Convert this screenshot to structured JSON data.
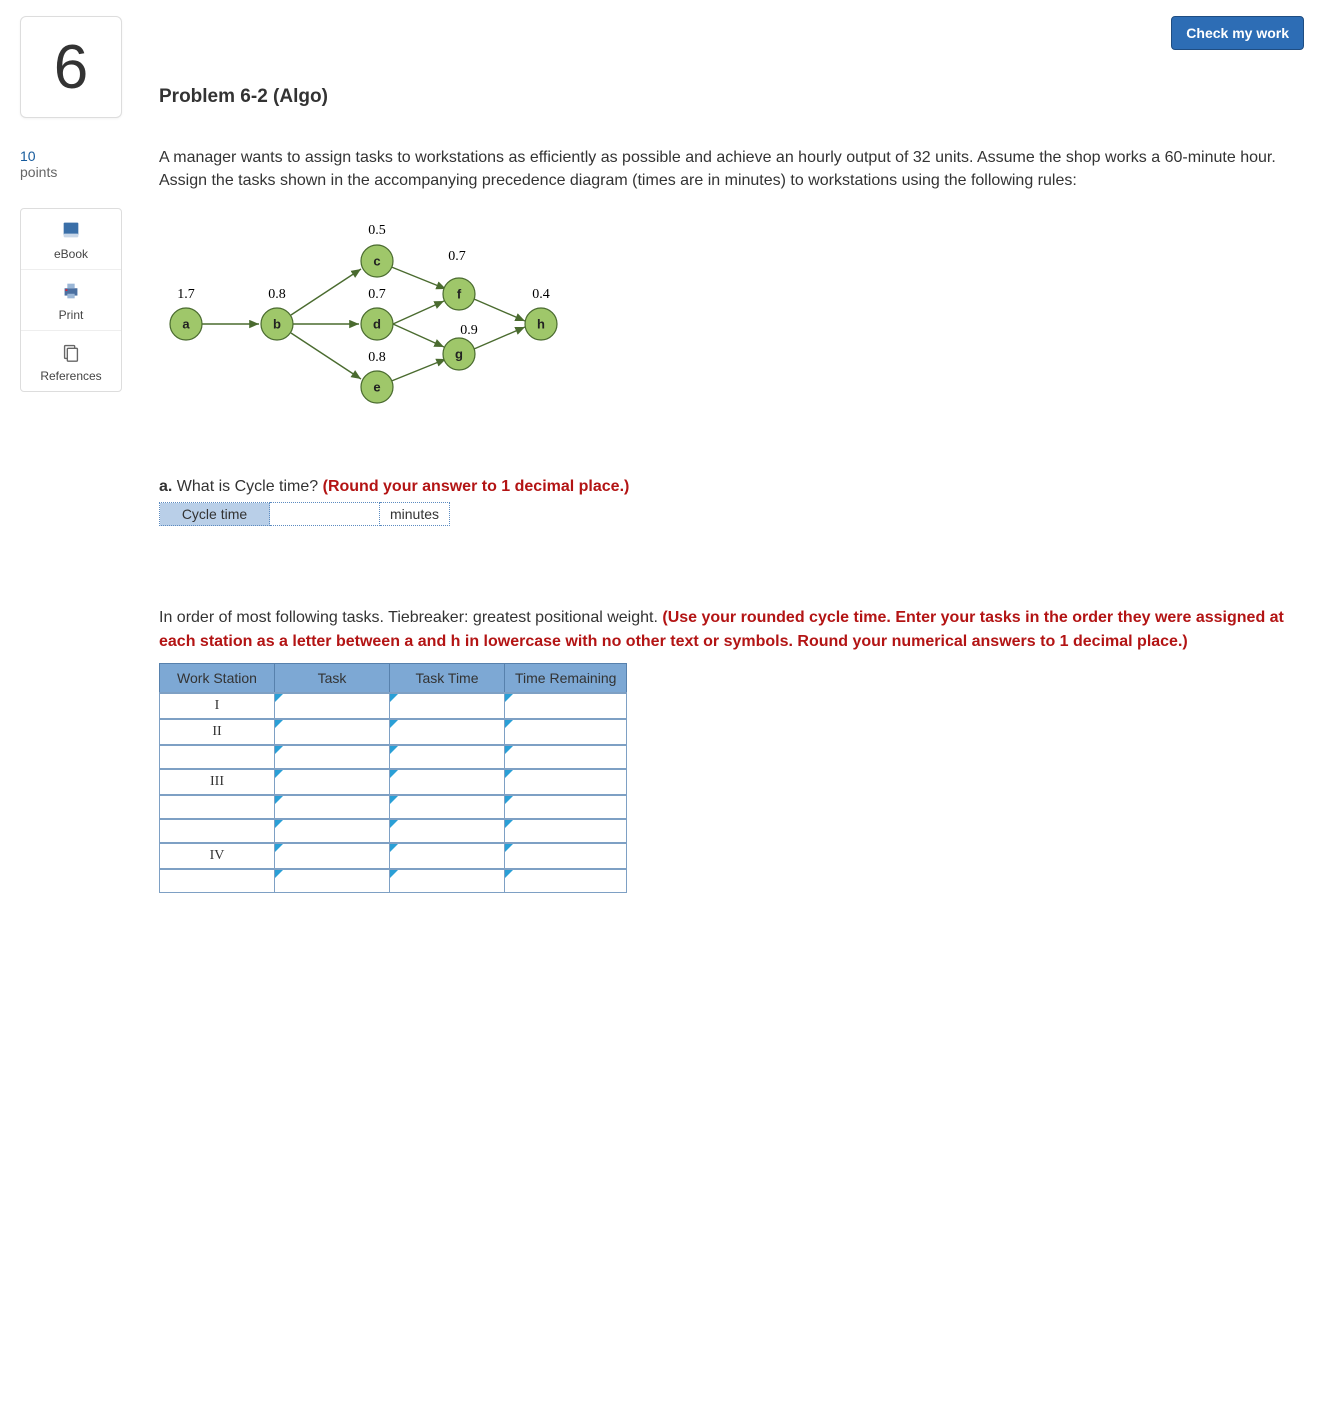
{
  "header": {
    "check_button": "Check my work"
  },
  "sidebar": {
    "question_number": "6",
    "points_value": "10",
    "points_label": "points",
    "tools": [
      {
        "label": "eBook"
      },
      {
        "label": "Print"
      },
      {
        "label": "References"
      }
    ]
  },
  "problem": {
    "title": "Problem 6-2 (Algo)",
    "prompt": "A manager wants to assign tasks to workstations as efficiently as possible and achieve an hourly output of 32 units. Assume the shop works a 60-minute hour. Assign the tasks shown in the accompanying precedence diagram (times are in minutes) to workstations using the following rules:"
  },
  "diagram": {
    "nodes": {
      "a": {
        "time": "1.7"
      },
      "b": {
        "time": "0.8"
      },
      "c": {
        "time": "0.5"
      },
      "d": {
        "time": "0.7"
      },
      "e": {
        "time": "0.8"
      },
      "f": {
        "time": "0.7"
      },
      "g": {
        "time": "0.9"
      },
      "h": {
        "time": "0.4"
      }
    }
  },
  "part_a": {
    "label": "a.",
    "question": " What is Cycle time? ",
    "hint": "(Round your answer to 1 decimal place.)",
    "row_label": "Cycle time",
    "unit": "minutes",
    "value": ""
  },
  "part_b": {
    "intro_plain": "In order of most following tasks. Tiebreaker: greatest positional weight. ",
    "intro_red": "(Use your rounded cycle time. Enter your tasks in the order they were assigned at each station as a letter between a and h in lowercase with no other text or symbols. Round your numerical answers to 1 decimal place.)",
    "headers": [
      "Work Station",
      "Task",
      "Task Time",
      "Time Remaining"
    ],
    "rows": [
      {
        "ws": "I"
      },
      {
        "ws": "II"
      },
      {
        "ws": ""
      },
      {
        "ws": "III"
      },
      {
        "ws": ""
      },
      {
        "ws": ""
      },
      {
        "ws": "IV"
      },
      {
        "ws": ""
      }
    ]
  }
}
